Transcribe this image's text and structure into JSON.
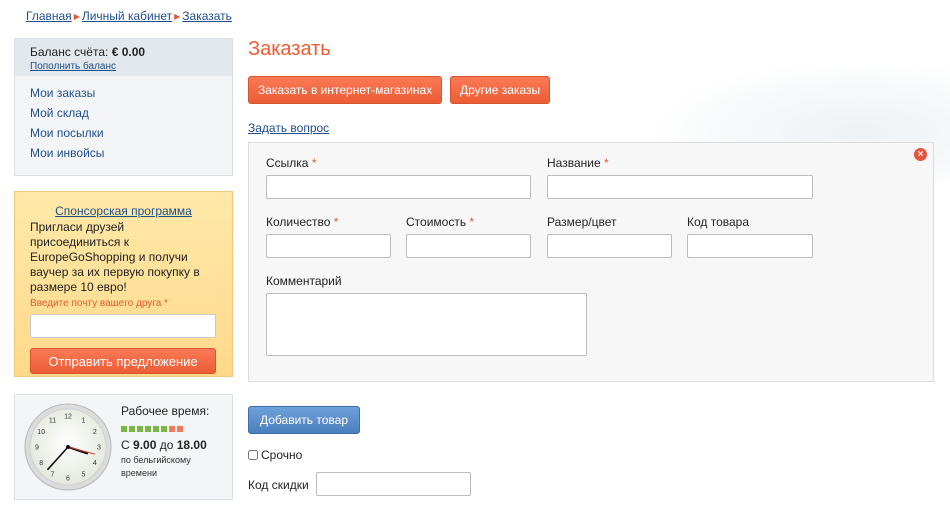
{
  "breadcrumb": [
    "Главная",
    "Личный кабинет",
    "Заказать"
  ],
  "account": {
    "balance_label": "Баланс счёта:",
    "balance_value": "€ 0.00",
    "topup": "Пополнить баланс",
    "menu": [
      "Мои заказы",
      "Мой склад",
      "Мои посылки",
      "Мои инвойсы"
    ]
  },
  "promo": {
    "title": "Спонсорская программа",
    "text": "Пригласи друзей присоединиться к EuropeGoShopping и получи ваучер за их первую покупку в размере 10 евро!",
    "email_label": "Введите почту вашего друга",
    "required_mark": "*",
    "email_value": "",
    "submit": "Отправить предложение"
  },
  "work_hours": {
    "title": "Рабочее время:",
    "from_prefix": "С",
    "from": "9.00",
    "to_prefix": "до",
    "to": "18.00",
    "note": "по бельгийскому времени",
    "bar_colors": [
      "#7ab648",
      "#7ab648",
      "#7ab648",
      "#7ab648",
      "#7ab648",
      "#7ab648",
      "#f07a5c",
      "#f07a5c"
    ],
    "clock_numbers": [
      "12",
      "1",
      "2",
      "3",
      "4",
      "5",
      "6",
      "7",
      "8",
      "9",
      "10",
      "11"
    ],
    "clock_time": "03:37"
  },
  "main": {
    "title": "Заказать",
    "order_shop_button": "Заказать в интернет-магазинах",
    "other_orders_button": "Другие заказы",
    "ask_link": "Задать вопрос",
    "form": {
      "link_label": "Ссылка",
      "name_label": "Название",
      "qty_label": "Количество",
      "price_label": "Стоимость",
      "size_label": "Размер/цвет",
      "code_label": "Код товара",
      "comment_label": "Комментарий",
      "required_mark": "*",
      "link_value": "",
      "name_value": "",
      "qty_value": "",
      "price_value": "",
      "size_value": "",
      "code_value": "",
      "comment_value": ""
    },
    "add_button": "Добавить товар",
    "urgent_label": "Срочно",
    "urgent_checked": false,
    "discount_label": "Код скидки",
    "discount_value": ""
  },
  "colors": {
    "accent": "#f05a2f",
    "link": "#1f4e8c",
    "primary_button": "#4a7fbe"
  }
}
